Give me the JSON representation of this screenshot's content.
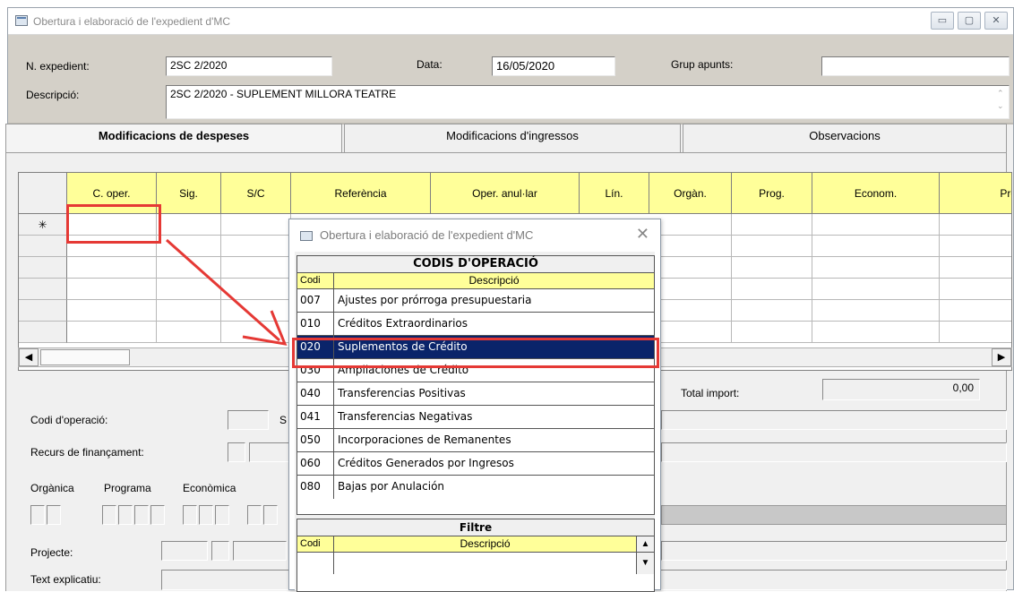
{
  "window": {
    "title": "Obertura i elaboració de l'expedient d'MC",
    "controls": [
      "▭",
      "▢",
      "✕"
    ]
  },
  "header": {
    "n_expedient_label": "N. expedient:",
    "n_expedient_value": "2SC 2/2020",
    "data_label": "Data:",
    "data_value": "16/05/2020",
    "grup_label": "Grup apunts:",
    "grup_value": "",
    "descripcio_label": "Descripció:",
    "descripcio_value": "2SC 2/2020 - SUPLEMENT MILLORA TEATRE"
  },
  "tabs": [
    {
      "label": "Modificacions de despeses",
      "active": true
    },
    {
      "label": "Modificacions d'ingressos",
      "active": false
    },
    {
      "label": "Observacions",
      "active": false
    }
  ],
  "grid": {
    "columns": [
      "C. oper.",
      "Sig.",
      "S/C",
      "Referència",
      "Oper. anul·lar",
      "Lín.",
      "Orgàn.",
      "Prog.",
      "Econom.",
      "Pro"
    ],
    "new_row_marker": "✳"
  },
  "scrollbar": {
    "left_arrow": "◀",
    "right_arrow": "▶"
  },
  "totals": {
    "label": "Total import:",
    "value": "0,00"
  },
  "form": {
    "codi_operacio_label": "Codi d'operació:",
    "codi_operacio_suffix": "S",
    "recurs_label": "Recurs de finançament:",
    "organica_label": "Orgànica",
    "programa_label": "Programa",
    "economica_label": "Econòmica",
    "projecte_label": "Projecte:",
    "text_label": "Text explicatiu:"
  },
  "dialog": {
    "title": "Obertura i elaboració de l'expedient d'MC",
    "close": "✕",
    "codis": {
      "title": "CODIS D'OPERACIÓ",
      "col_codi": "Codi",
      "col_desc": "Descripció",
      "rows": [
        {
          "codi": "007",
          "desc": "Ajustes por prórroga presupuestaria"
        },
        {
          "codi": "010",
          "desc": "Créditos Extraordinarios"
        },
        {
          "codi": "020",
          "desc": "Suplementos de Crédito"
        },
        {
          "codi": "030",
          "desc": "Ampliaciones de Crédito"
        },
        {
          "codi": "040",
          "desc": "Transferencias Positivas"
        },
        {
          "codi": "041",
          "desc": "Transferencias Negativas"
        },
        {
          "codi": "050",
          "desc": "Incorporaciones de Remanentes"
        },
        {
          "codi": "060",
          "desc": "Créditos Generados por Ingresos"
        },
        {
          "codi": "080",
          "desc": "Bajas por Anulación"
        }
      ],
      "selected_index": 2
    },
    "filtre": {
      "title": "Filtre",
      "col_codi": "Codi",
      "col_desc": "Descripció",
      "up": "▲",
      "down": "▼"
    }
  },
  "colors": {
    "selection": "#0a246a",
    "header_yellow": "#ffff99",
    "highlight_red": "#e53935"
  }
}
